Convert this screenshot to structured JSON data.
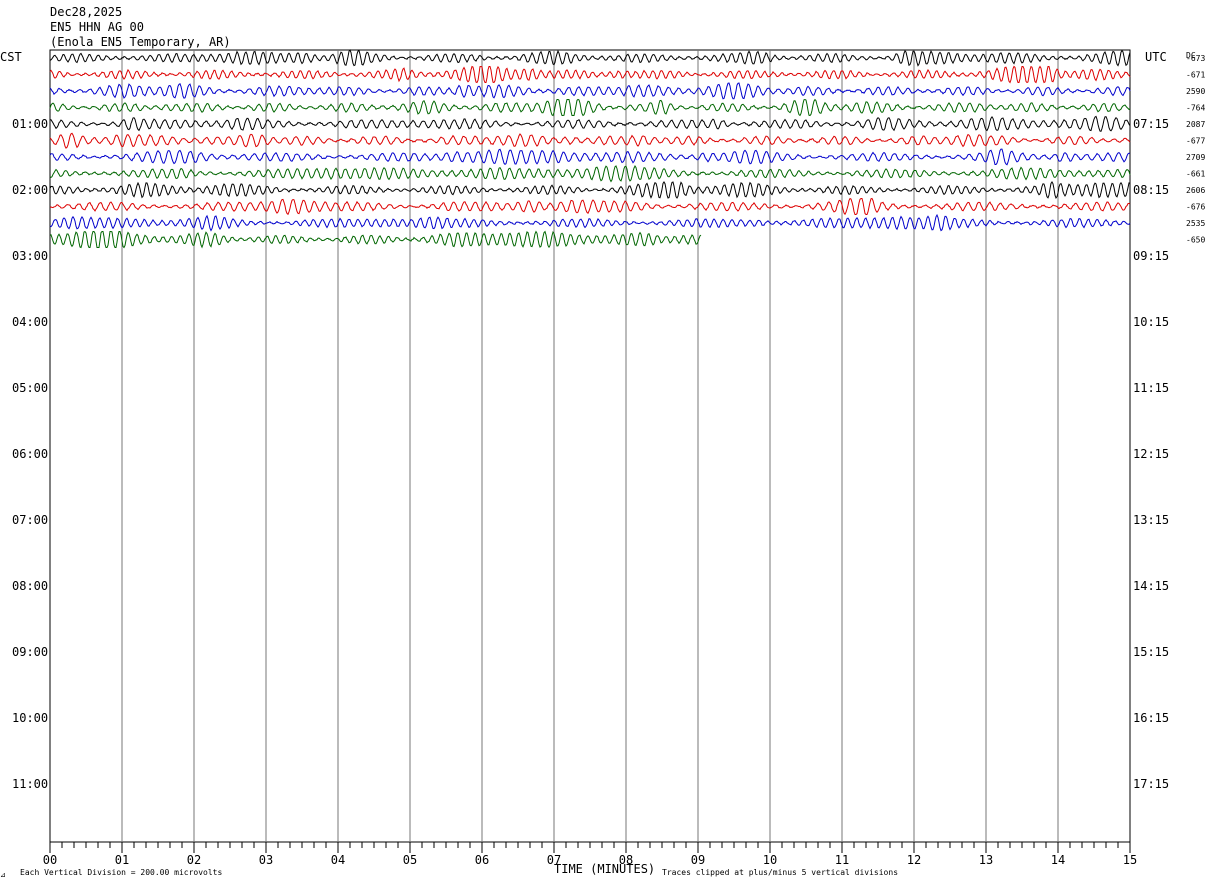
{
  "header": {
    "date": "Dec28,2025",
    "station": "EN5 HHN AG 00",
    "location": "(Enola EN5 Temporary, AR)"
  },
  "left_tz": "CST",
  "right_tz": "UTC",
  "dc_label": "DC",
  "footer": {
    "scale_note": "Each Vertical Division =  200.00 microvolts",
    "xlabel": "TIME (MINUTES)",
    "clip_note": "Traces clipped at plus/minus 5 vertical divisions"
  },
  "colors": {
    "black": "#000000",
    "red": "#dd0000",
    "blue": "#0000cc",
    "green": "#006600",
    "grid": "#777777"
  },
  "chart_data": {
    "type": "line",
    "title": "EN5 HHN AG 00",
    "xlabel": "TIME (MINUTES)",
    "x_ticks": [
      "00",
      "01",
      "02",
      "03",
      "04",
      "05",
      "06",
      "07",
      "08",
      "09",
      "10",
      "11",
      "12",
      "13",
      "14",
      "15"
    ],
    "xlim": [
      0,
      15
    ],
    "rows_per_hour": 4,
    "left_hour_labels": [
      "01:00",
      "02:00",
      "03:00",
      "04:00",
      "05:00",
      "06:00",
      "07:00",
      "08:00",
      "09:00",
      "10:00",
      "11:00"
    ],
    "right_hour_labels": [
      "07:15",
      "08:15",
      "09:15",
      "10:15",
      "11:15",
      "12:15",
      "13:15",
      "14:15",
      "15:15",
      "16:15",
      "17:15"
    ],
    "color_cycle": [
      "black",
      "red",
      "blue",
      "green"
    ],
    "traces": [
      {
        "row": 0,
        "dc": "-673",
        "end_minute": 15
      },
      {
        "row": 1,
        "dc": "-671",
        "end_minute": 15
      },
      {
        "row": 2,
        "dc": "2590",
        "end_minute": 15
      },
      {
        "row": 3,
        "dc": "-764",
        "end_minute": 15
      },
      {
        "row": 4,
        "dc": "2087",
        "end_minute": 15
      },
      {
        "row": 5,
        "dc": "-677",
        "end_minute": 15
      },
      {
        "row": 6,
        "dc": "2709",
        "end_minute": 15
      },
      {
        "row": 7,
        "dc": "-661",
        "end_minute": 15
      },
      {
        "row": 8,
        "dc": "2606",
        "end_minute": 15
      },
      {
        "row": 9,
        "dc": "-676",
        "end_minute": 15
      },
      {
        "row": 10,
        "dc": "2535",
        "end_minute": 15
      },
      {
        "row": 11,
        "dc": "-650",
        "end_minute": 9.05
      }
    ]
  }
}
